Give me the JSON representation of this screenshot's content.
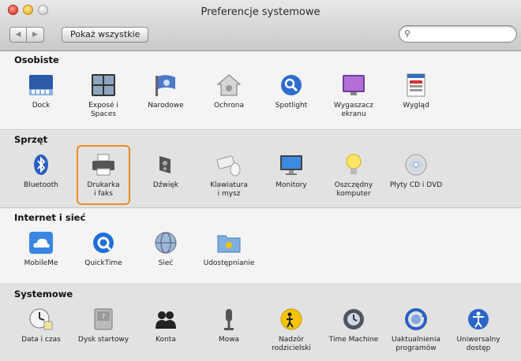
{
  "window": {
    "title": "Preferencje systemowe"
  },
  "toolbar": {
    "back_label": "◀",
    "forward_label": "▶",
    "show_all_label": "Pokaż wszystkie",
    "search_value": ""
  },
  "sections": [
    {
      "title": "Osobiste",
      "items": [
        {
          "label": "Dock",
          "icon": "dock-icon"
        },
        {
          "label": "Exposé i\nSpaces",
          "icon": "expose-spaces-icon"
        },
        {
          "label": "Narodowe",
          "icon": "international-flag-icon"
        },
        {
          "label": "Ochrona",
          "icon": "security-house-icon"
        },
        {
          "label": "Spotlight",
          "icon": "spotlight-magnifier-icon"
        },
        {
          "label": "Wygaszacz\nekranu",
          "icon": "screensaver-icon"
        },
        {
          "label": "Wygląd",
          "icon": "appearance-icon"
        }
      ]
    },
    {
      "title": "Sprzęt",
      "items": [
        {
          "label": "Bluetooth",
          "icon": "bluetooth-icon"
        },
        {
          "label": "Drukarka\ni faks",
          "icon": "printer-icon"
        },
        {
          "label": "Dźwięk",
          "icon": "speaker-icon"
        },
        {
          "label": "Klawiatura\ni mysz",
          "icon": "keyboard-mouse-icon"
        },
        {
          "label": "Monitory",
          "icon": "display-icon"
        },
        {
          "label": "Oszczędny\nkomputer",
          "icon": "lightbulb-icon"
        },
        {
          "label": "Płyty CD i DVD",
          "icon": "cd-dvd-icon"
        }
      ]
    },
    {
      "title": "Internet i sieć",
      "items": [
        {
          "label": "MobileMe",
          "icon": "mobileme-cloud-icon"
        },
        {
          "label": "QuickTime",
          "icon": "quicktime-icon"
        },
        {
          "label": "Sieć",
          "icon": "network-globe-icon"
        },
        {
          "label": "Udostępnianie",
          "icon": "sharing-folder-icon"
        }
      ]
    },
    {
      "title": "Systemowe",
      "items": [
        {
          "label": "Data i czas",
          "icon": "date-time-clock-icon"
        },
        {
          "label": "Dysk startowy",
          "icon": "startup-disk-icon"
        },
        {
          "label": "Konta",
          "icon": "accounts-icon"
        },
        {
          "label": "Mowa",
          "icon": "speech-microphone-icon"
        },
        {
          "label": "Nadzór\nrodzicielski",
          "icon": "parental-controls-icon"
        },
        {
          "label": "Time Machine",
          "icon": "time-machine-icon"
        },
        {
          "label": "Uaktualnienia\nprogramów",
          "icon": "software-update-icon"
        },
        {
          "label": "Uniwersalny\ndostęp",
          "icon": "universal-access-icon"
        }
      ]
    }
  ],
  "highlight_color": "#f08a1c"
}
